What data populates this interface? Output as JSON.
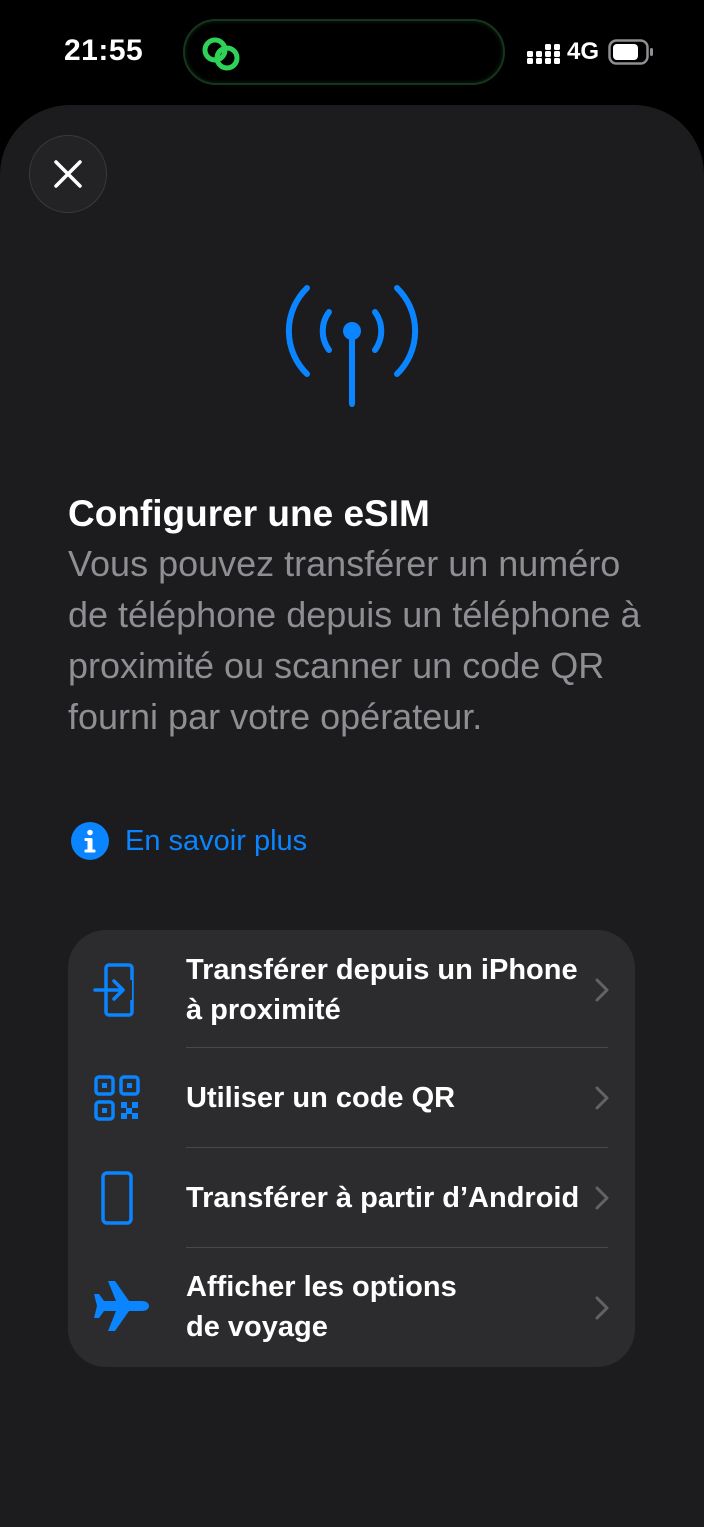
{
  "status_bar": {
    "time": "21:55",
    "network": "4G"
  },
  "sheet": {
    "title": "Configurer une eSIM",
    "description": "Vous pouvez transférer un numéro de téléphone depuis un téléphone à proximité ou scanner un code QR fourni par votre opérateur.",
    "learn_more": "En savoir plus",
    "options": [
      {
        "line1": "Transférer depuis un iPhone",
        "line2": "à proximité",
        "icon": "transfer-in-icon"
      },
      {
        "line1": "Utiliser un code QR",
        "icon": "qr-code-icon"
      },
      {
        "line1": "Transférer à partir d’Android",
        "icon": "phone-icon"
      },
      {
        "line1": "Afficher les options",
        "line2": "de voyage",
        "icon": "airplane-icon"
      }
    ]
  },
  "colors": {
    "accent": "#0a84ff",
    "background": "#000000",
    "sheet": "#1c1c1e",
    "card": "#2c2c2e",
    "secondary_text": "#8e8e93"
  }
}
